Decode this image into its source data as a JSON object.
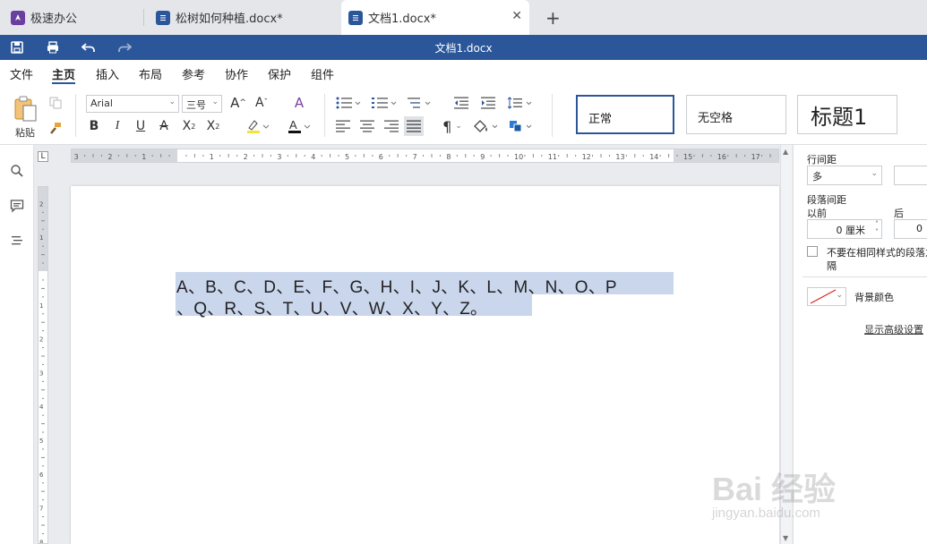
{
  "tabs": [
    {
      "label": "极速办公",
      "icon": "rocket-icon",
      "active": false
    },
    {
      "label": "松树如何种植.docx*",
      "icon": "document-icon",
      "active": false
    },
    {
      "label": "文档1.docx*",
      "icon": "document-icon",
      "active": true
    }
  ],
  "title_bar": {
    "title": "文档1.docx",
    "quick_actions": [
      "save-icon",
      "print-icon",
      "undo-icon",
      "redo-icon"
    ]
  },
  "menu": {
    "items": [
      "文件",
      "主页",
      "插入",
      "布局",
      "参考",
      "协作",
      "保护",
      "组件"
    ],
    "active": "主页"
  },
  "ribbon": {
    "paste_label": "粘贴",
    "font_name": "Arial",
    "font_size": "三号",
    "styles": [
      "正常",
      "无空格",
      "标题1"
    ],
    "selected_style": "正常"
  },
  "document": {
    "lines": [
      "A、B、C、D、E、F、G、H、I、J、K、L、M、N、O、P",
      "、Q、R、S、T、U、V、W、X、Y、Z。"
    ],
    "highlight_color": "#c9d6ec"
  },
  "right_panel": {
    "line_spacing_label": "行间距",
    "line_spacing_value": "多",
    "paragraph_spacing_label": "段落间距",
    "before_label": "以前",
    "before_value": "0 厘米",
    "after_label": "后",
    "after_value": "0",
    "no_space_checkbox_line1": "不要在相同样式的段落之",
    "no_space_checkbox_line2": "隔",
    "bg_color_label": "背景颜色",
    "advanced_link": "显示高级设置"
  },
  "watermark": {
    "text": "Bai 经验",
    "sub": "jingyan.baidu.com"
  },
  "colors": {
    "title_bar": "#2b579a",
    "tab_bar": "#e4e6ea",
    "selection": "#c9d6ec"
  }
}
